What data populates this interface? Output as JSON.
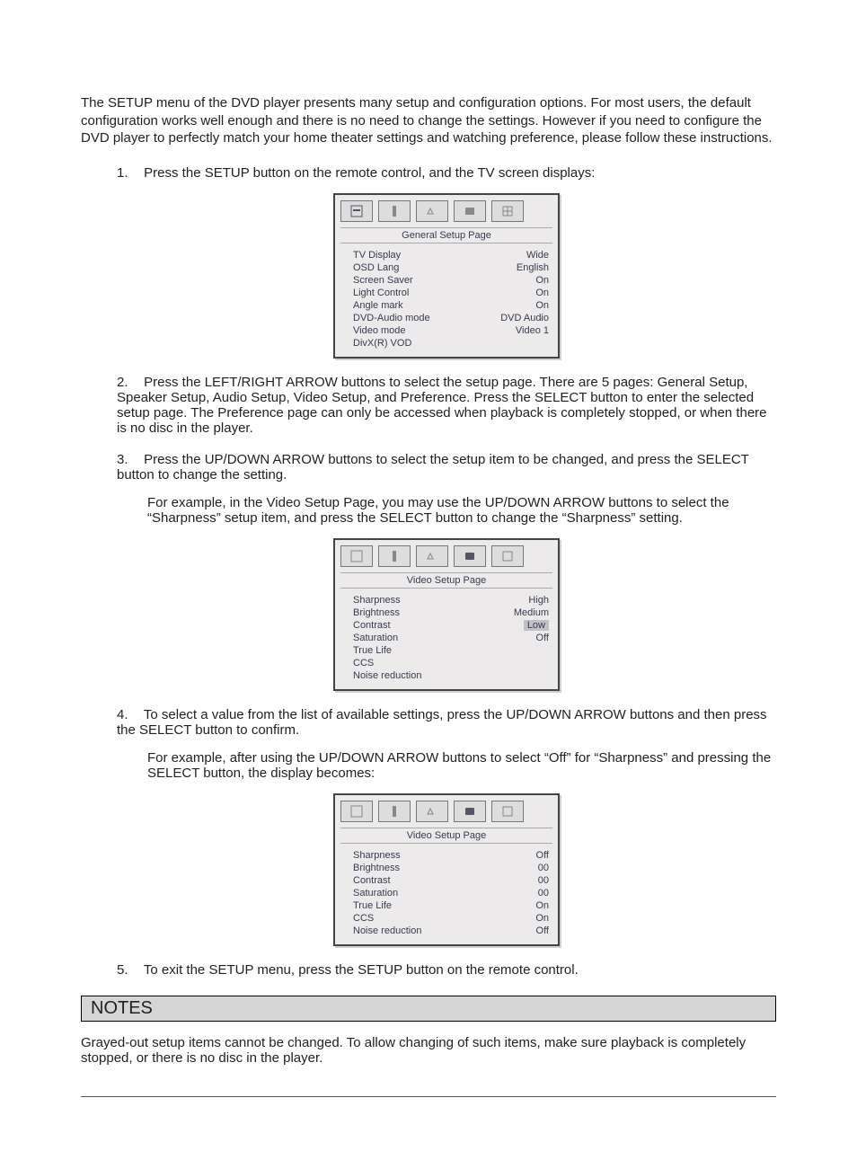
{
  "intro": "The SETUP menu of the DVD player presents many setup and configuration options.  For most users, the default configuration works well enough and there is no need to change the settings.  However if you need to configure the DVD player to perfectly match your home theater settings and watching preference, please follow these instructions.",
  "steps": {
    "s1": "Press the SETUP button on the remote control, and the TV screen displays:",
    "s2": "Press the LEFT/RIGHT ARROW buttons to select the setup page.  There are 5 pages: General Setup, Speaker Setup, Audio Setup, Video Setup, and Preference.  Press the SELECT button to enter the selected setup page.  The Preference page can only be accessed when playback is completely stopped, or when there is no disc in the player.",
    "s3": "Press the UP/DOWN ARROW buttons to select the setup item to be changed, and press the SELECT button to change the setting.",
    "s3b": "For example, in the Video Setup Page, you may use the UP/DOWN ARROW buttons to select the “Sharpness” setup item, and press the SELECT button to change the “Sharpness” setting.",
    "s4": "To select a value from the list of available settings, press the UP/DOWN ARROW buttons and then press the SELECT button to confirm.",
    "s4b": "For example, after using the UP/DOWN ARROW buttons to select “Off” for “Sharpness” and pressing the SELECT button, the display becomes:",
    "s5": "To exit the SETUP menu, press the SETUP button on the remote control."
  },
  "box1": {
    "title": "General Setup Page",
    "rows": [
      {
        "label": "TV Display",
        "val": "Wide"
      },
      {
        "label": "OSD Lang",
        "val": "English"
      },
      {
        "label": "Screen Saver",
        "val": "On"
      },
      {
        "label": "Light Control",
        "val": "On"
      },
      {
        "label": "Angle mark",
        "val": "On"
      },
      {
        "label": "DVD-Audio mode",
        "val": "DVD Audio"
      },
      {
        "label": "Video mode",
        "val": "Video 1"
      },
      {
        "label": "DivX(R) VOD",
        "val": ""
      }
    ]
  },
  "box2": {
    "title": "Video Setup Page",
    "rows": [
      {
        "label": "Sharpness",
        "val": "High"
      },
      {
        "label": "Brightness",
        "val": "Medium"
      },
      {
        "label": "Contrast",
        "val": "Low",
        "hl": true
      },
      {
        "label": "Saturation",
        "val": "Off"
      },
      {
        "label": "True Life",
        "val": ""
      },
      {
        "label": "CCS",
        "val": ""
      },
      {
        "label": "Noise reduction",
        "val": ""
      }
    ]
  },
  "box3": {
    "title": "Video Setup Page",
    "rows": [
      {
        "label": "Sharpness",
        "val": "Off"
      },
      {
        "label": "Brightness",
        "val": "00"
      },
      {
        "label": "Contrast",
        "val": "00"
      },
      {
        "label": "Saturation",
        "val": "00"
      },
      {
        "label": "True Life",
        "val": "On"
      },
      {
        "label": "CCS",
        "val": "On"
      },
      {
        "label": "Noise reduction",
        "val": "Off"
      }
    ]
  },
  "notes": {
    "header": "NOTES",
    "body": "Grayed-out setup items cannot be changed.  To allow changing of such items, make sure playback is completely stopped, or there is no disc in the player."
  },
  "nums": {
    "n1": "1.",
    "n2": "2.",
    "n3": "3.",
    "n4": "4.",
    "n5": "5."
  }
}
